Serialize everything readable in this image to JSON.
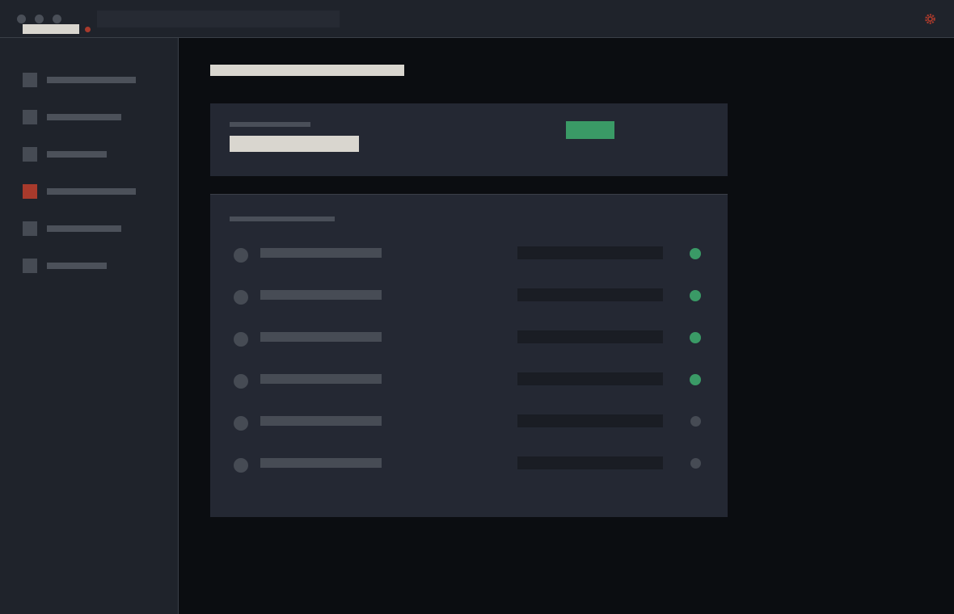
{
  "window": {
    "controls": [
      "window-control-dot",
      "window-control-dot",
      "window-control-dot"
    ],
    "alert_icon": "alert-dot-icon",
    "settings_icon": "gear-icon"
  },
  "search": {
    "placeholder": "",
    "value": ""
  },
  "sidebar": {
    "items": [
      {
        "icon": "nav-item-icon",
        "active": false
      },
      {
        "icon": "nav-item-icon",
        "active": false
      },
      {
        "icon": "nav-item-icon",
        "active": false
      },
      {
        "icon": "nav-item-icon",
        "active": true
      },
      {
        "icon": "nav-item-icon",
        "active": false
      },
      {
        "icon": "nav-item-icon",
        "active": false
      }
    ]
  },
  "summary": {
    "status": "online"
  },
  "list": {
    "rows": [
      {
        "status": "online"
      },
      {
        "status": "online"
      },
      {
        "status": "online"
      },
      {
        "status": "online"
      },
      {
        "status": "offline"
      },
      {
        "status": "offline"
      }
    ]
  },
  "colors": {
    "accent": "#a83a2c",
    "success": "#3a9a66",
    "panel": "#242833",
    "chrome": "#1f232b",
    "background": "#0b0d11",
    "title_text": "#d9d6cf"
  }
}
